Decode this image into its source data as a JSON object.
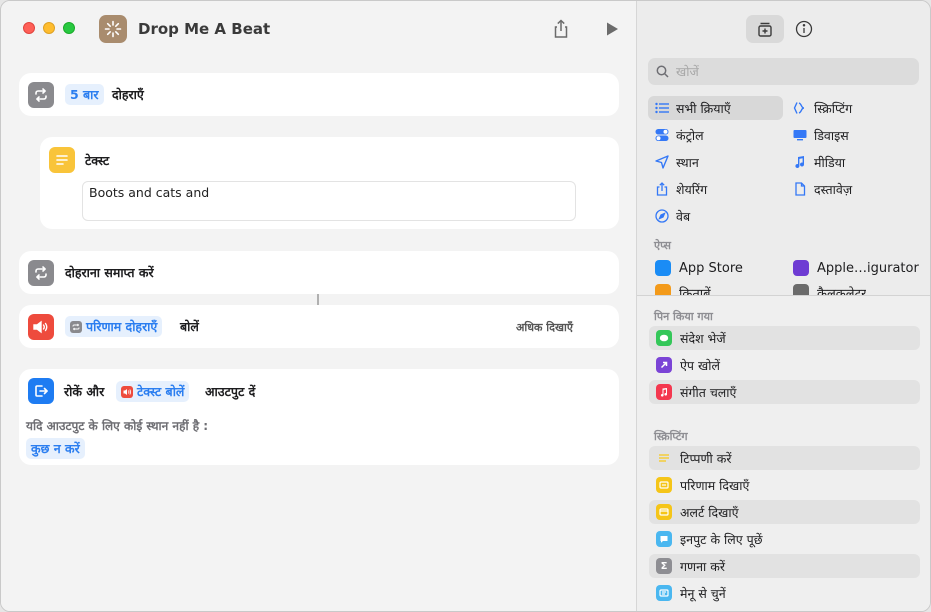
{
  "window": {
    "title": "Drop Me A Beat"
  },
  "actions": {
    "repeat": {
      "count_token": "5 बार",
      "label": "दोहराएँ"
    },
    "text": {
      "label": "टेक्स्ट",
      "value": "Boots and cats and"
    },
    "end_repeat": {
      "label": "दोहराना समाप्त करें"
    },
    "speak": {
      "token": "परिणाम दोहराएँ",
      "label": "बोलें",
      "show_more": "अधिक दिखाएँ"
    },
    "stop": {
      "label_a": "रोकें और",
      "token": "टेक्स्ट बोलें",
      "label_b": "आउटपुट दें",
      "condition": "यदि आउटपुट के लिए कोई स्थान नहीं है :",
      "fallback": "कुछ न करें"
    }
  },
  "sidebar": {
    "search_placeholder": "खोजें",
    "categories": [
      {
        "label": "सभी क्रियाएँ",
        "icon": "list-icon",
        "selected": true
      },
      {
        "label": "स्क्रिप्टिंग",
        "icon": "scripting-icon"
      },
      {
        "label": "कंट्रोल",
        "icon": "toggle-icon"
      },
      {
        "label": "डिवाइस",
        "icon": "monitor-icon"
      },
      {
        "label": "स्थान",
        "icon": "location-arrow-icon"
      },
      {
        "label": "मीडिया",
        "icon": "music-note-icon"
      },
      {
        "label": "शेयरिंग",
        "icon": "share-icon"
      },
      {
        "label": "दस्तावेज़",
        "icon": "document-icon"
      },
      {
        "label": "वेब",
        "icon": "compass-icon"
      }
    ],
    "apps_header": "ऐप्स",
    "apps": [
      {
        "label": "App Store",
        "color": "#1a8cf5"
      },
      {
        "label": "Apple…igurator",
        "color": "#6e3bd3"
      },
      {
        "label": "किताबें",
        "color": "#f39a1a"
      },
      {
        "label": "कैलकुलेटर",
        "color": "#6b6b6b"
      }
    ],
    "pinned_header": "पिन किया गया",
    "pinned": [
      {
        "label": "संदेश भेजें",
        "color": "#34c759"
      },
      {
        "label": "ऐप खोलें",
        "color": "#7b44d6"
      },
      {
        "label": "संगीत चलाएँ",
        "color": "#f4384f"
      }
    ],
    "scripting_header": "स्क्रिप्टिंग",
    "scripting": [
      {
        "label": "टिप्पणी करें",
        "color": "#f5cd3a"
      },
      {
        "label": "परिणाम दिखाएँ",
        "color": "#f5c518"
      },
      {
        "label": "अलर्ट दिखाएँ",
        "color": "#f5c518"
      },
      {
        "label": "इनपुट के लिए पूछें",
        "color": "#4ab7f0"
      },
      {
        "label": "गणना करें",
        "color": "#8e8e93"
      },
      {
        "label": "मेनू से चुनें",
        "color": "#4ab7f0"
      }
    ]
  }
}
